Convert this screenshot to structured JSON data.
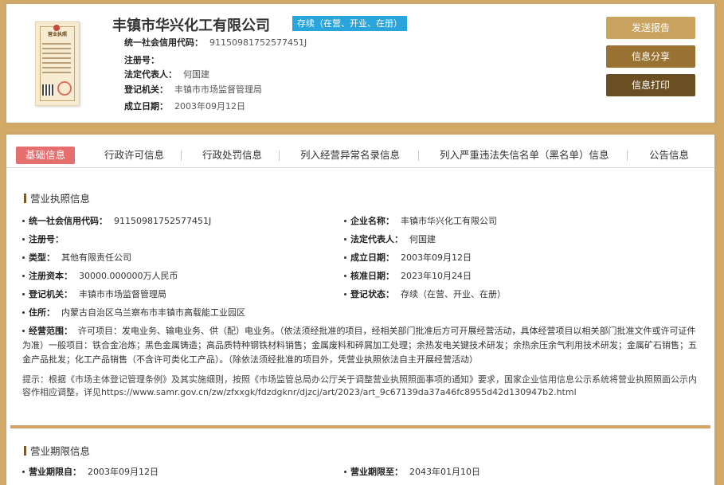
{
  "header": {
    "company_name": "丰镇市华兴化工有限公司",
    "status_badge": "存续（在营、开业、在册）",
    "rows": [
      {
        "label": "统一社会信用代码：",
        "value": "91150981752577451J"
      },
      {
        "label": "注册号：",
        "value": ""
      },
      {
        "label": "法定代表人：",
        "value": "何国建"
      },
      {
        "label": "登记机关：",
        "value": "丰镇市市场监督管理局"
      },
      {
        "label": "成立日期：",
        "value": "2003年09月12日"
      }
    ],
    "license_title": "营业执照"
  },
  "actions": {
    "send_report": "发送报告",
    "share": "信息分享",
    "print": "信息打印"
  },
  "tabs": [
    {
      "label": "基础信息",
      "active": true
    },
    {
      "label": "行政许可信息"
    },
    {
      "label": "行政处罚信息"
    },
    {
      "label": "列入经营异常名录信息"
    },
    {
      "label": "列入严重违法失信名单（黑名单）信息"
    },
    {
      "label": "公告信息"
    }
  ],
  "license_section": {
    "title": "营业执照信息",
    "fields": [
      {
        "label": "统一社会信用代码：",
        "value": "91150981752577451J"
      },
      {
        "label": "企业名称：",
        "value": "丰镇市华兴化工有限公司"
      },
      {
        "label": "注册号：",
        "value": ""
      },
      {
        "label": "法定代表人：",
        "value": "何国建"
      },
      {
        "label": "类型：",
        "value": "其他有限责任公司"
      },
      {
        "label": "成立日期：",
        "value": "2003年09月12日"
      },
      {
        "label": "注册资本：",
        "value": "30000.000000万人民币"
      },
      {
        "label": "核准日期：",
        "value": "2023年10月24日"
      },
      {
        "label": "登记机关：",
        "value": "丰镇市市场监督管理局"
      },
      {
        "label": "登记状态：",
        "value": "存续（在营、开业、在册）"
      },
      {
        "label": "住所：",
        "value": "内蒙古自治区乌兰察布市丰镇市高载能工业园区"
      }
    ],
    "scope_label": "经营范围：",
    "scope_value": "许可项目：发电业务、输电业务、供（配）电业务。（依法须经批准的项目，经相关部门批准后方可开展经营活动，具体经营项目以相关部门批准文件或许可证件为准）一般项目：铁合金冶炼；黑色金属铸造；高品质特种钢铁材料销售；金属废料和碎屑加工处理；余热发电关键技术研发；余热余压余气利用技术研发；金属矿石销售；五金产品批发；化工产品销售（不含许可类化工产品）。（除依法须经批准的项目外，凭营业执照依法自主开展经营活动）",
    "tip": "提示：根据《市场主体登记管理条例》及其实施细则，按照《市场监管总局办公厅关于调整营业执照照面事项的通知》要求，国家企业信用信息公示系统将营业执照照面公示内容作相应调整，详见https://www.samr.gov.cn/zw/zfxxgk/fdzdgknr/djzcj/art/2023/art_9c67139da37a46fc8955d42d130947b2.html"
  },
  "term_section": {
    "title": "营业期限信息",
    "from_label": "营业期限自：",
    "from_value": "2003年09月12日",
    "to_label": "营业期限至：",
    "to_value": "2043年01月10日"
  }
}
